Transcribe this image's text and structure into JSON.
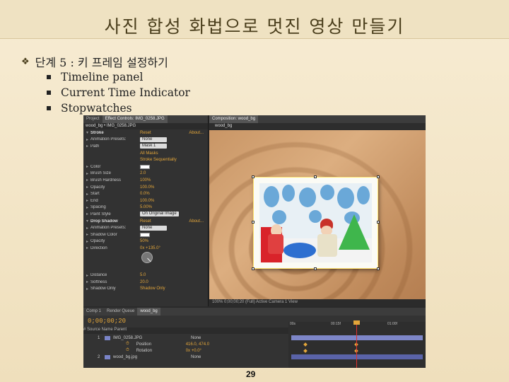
{
  "slide": {
    "title": "사진 합성 화법으로 멋진 영상 만들기",
    "page_number": "29",
    "bullet_main": "단계 5 : 키 프레임 설정하기",
    "sub_bullets": [
      "Timeline panel",
      "Current Time Indicator",
      "Stopwatches"
    ]
  },
  "ae": {
    "effect_controls": {
      "tabs": [
        "Project",
        "Effect Controls: IMG_0258.JPG"
      ],
      "layer": "wood_bg • IMG_0258.JPG",
      "rows": [
        {
          "name": "Stroke",
          "value": "Reset",
          "link": "About...",
          "fx": true
        },
        {
          "name": "Animation Presets:",
          "value": "None"
        },
        {
          "name": "Path",
          "value": "Mask 1"
        },
        {
          "name": "",
          "value": "All Masks"
        },
        {
          "name": "",
          "value": "Stroke Sequentially"
        },
        {
          "name": "Color",
          "value": ""
        },
        {
          "name": "Brush Size",
          "value": "2.0"
        },
        {
          "name": "Brush Hardness",
          "value": "100%"
        },
        {
          "name": "Opacity",
          "value": "100.0%"
        },
        {
          "name": "Start",
          "value": "0.0%"
        },
        {
          "name": "End",
          "value": "100.0%"
        },
        {
          "name": "Spacing",
          "value": "5.00%"
        },
        {
          "name": "Paint Style",
          "value": "On Original Image"
        },
        {
          "name": "Drop Shadow",
          "value": "Reset",
          "link": "About...",
          "fx": true
        },
        {
          "name": "Animation Presets:",
          "value": "None"
        },
        {
          "name": "Shadow Color",
          "value": ""
        },
        {
          "name": "Opacity",
          "value": "50%"
        },
        {
          "name": "Direction",
          "value": "0x +135.0°"
        },
        {
          "name": "",
          "value": ""
        },
        {
          "name": "",
          "value": ""
        },
        {
          "name": "",
          "value": ""
        },
        {
          "name": "Distance",
          "value": "5.0"
        },
        {
          "name": "Softness",
          "value": "20.0"
        },
        {
          "name": "Shadow Only",
          "value": "Shadow Only"
        }
      ]
    },
    "composition": {
      "tab": "Composition: wood_bg",
      "sub": "wood_bg",
      "footer": "100%   0;00;00;20   (Full)   Active Camera   1 View"
    },
    "timeline": {
      "tabs": [
        "Comp 1",
        "Render Queue",
        "wood_bg"
      ],
      "timecode": "0;00;00;20",
      "columns": "# Source Name          Parent",
      "layers": [
        {
          "num": "1",
          "name": "IMG_0258.JPG",
          "parent": "None"
        },
        {
          "num": "",
          "name": "Position",
          "parent": "416.0, 474.0"
        },
        {
          "num": "",
          "name": "Rotation",
          "parent": "0x +0.0°"
        },
        {
          "num": "2",
          "name": "wood_bg.jpg",
          "parent": "None"
        }
      ],
      "ruler": [
        "00s",
        "00:15f",
        "01:00f"
      ]
    }
  }
}
